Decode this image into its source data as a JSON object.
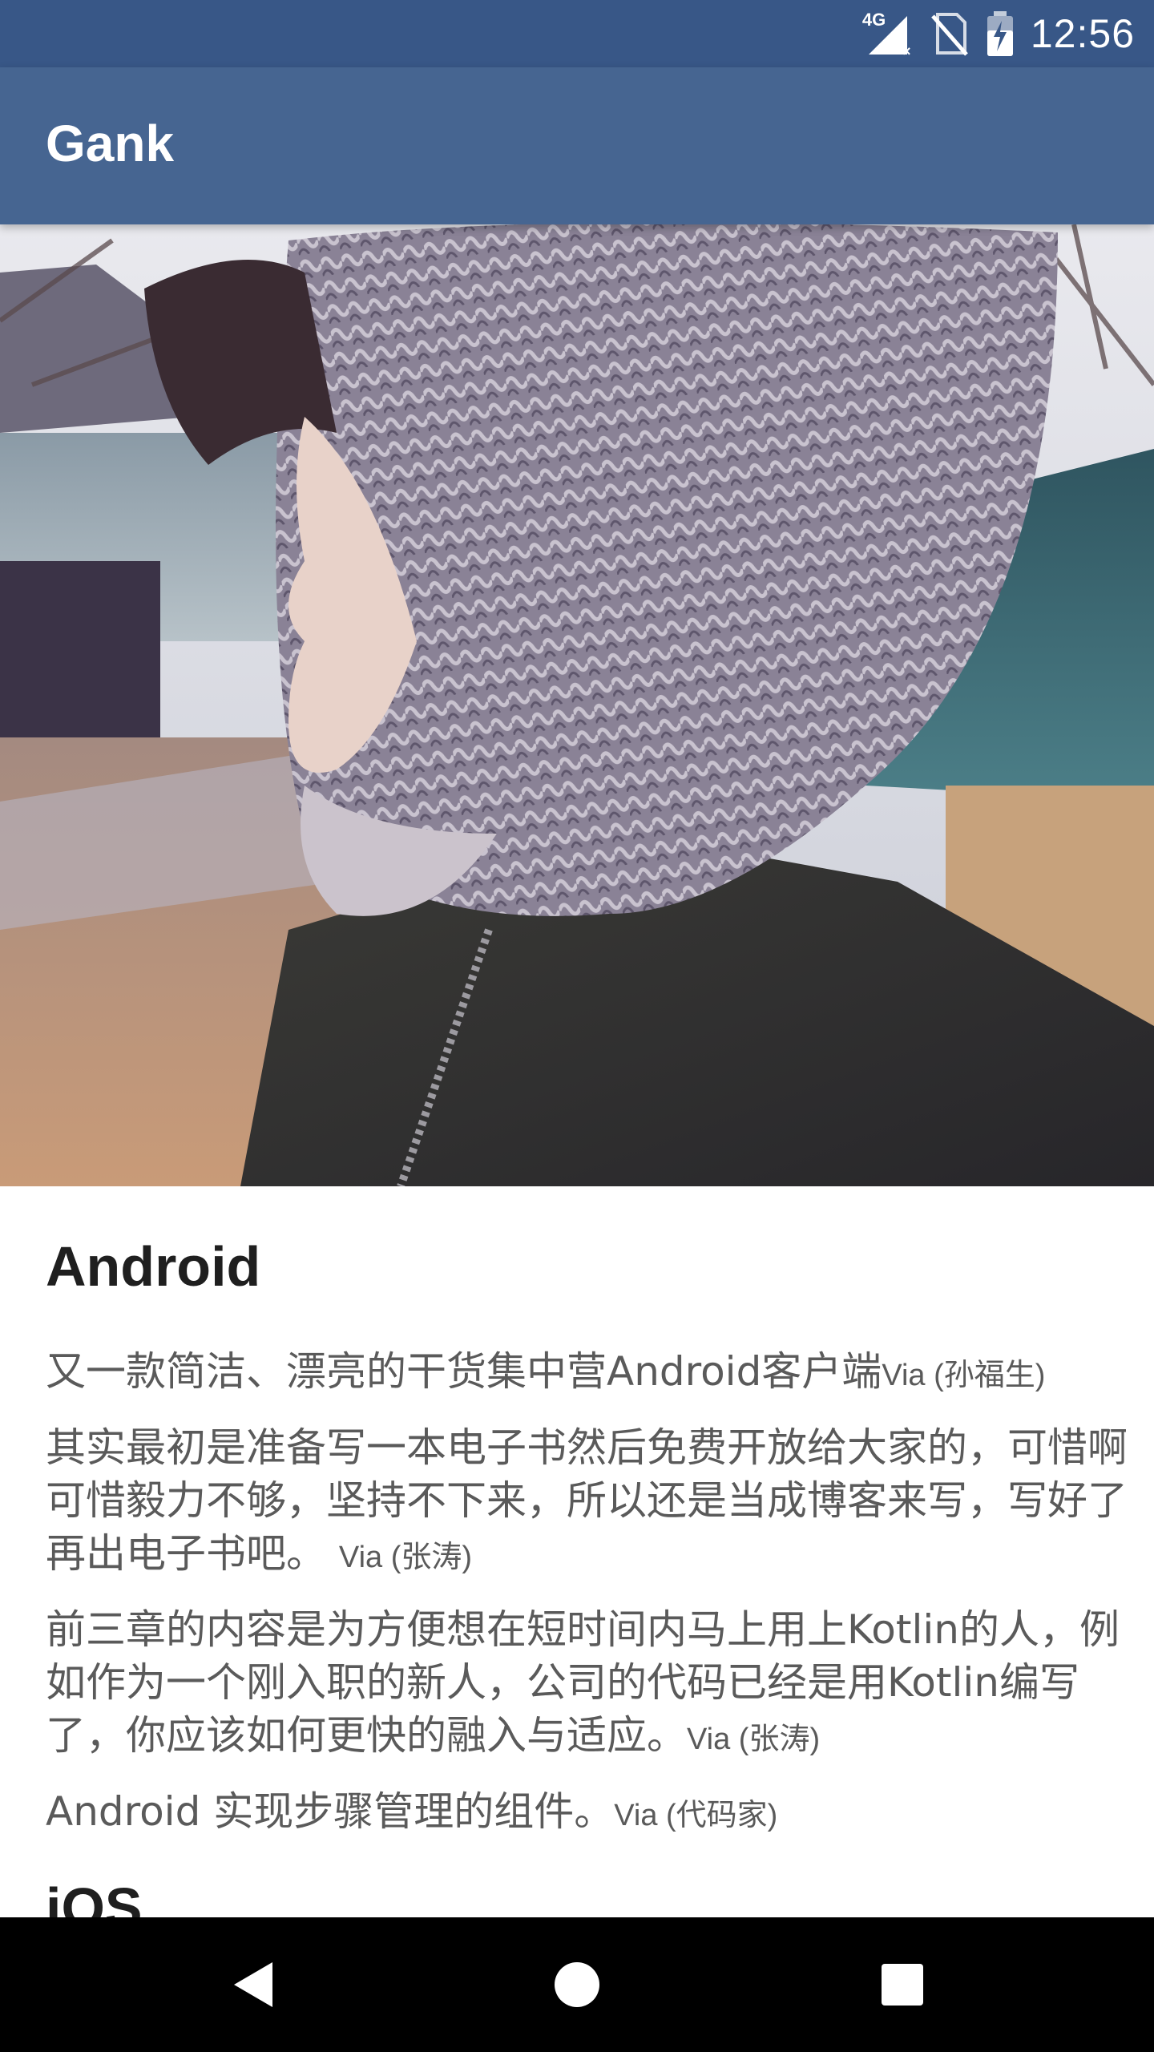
{
  "status_bar": {
    "network_label": "4G",
    "time": "12:56",
    "icons": [
      "signal-4g-icon",
      "no-sim-icon",
      "battery-charging-icon"
    ]
  },
  "app_bar": {
    "title": "Gank"
  },
  "hero": {
    "image": "photo-of-person-in-knit-hood"
  },
  "sections": [
    {
      "title": "Android",
      "entries": [
        {
          "text": "又一款简洁、漂亮的干货集中营Android客户端",
          "via": "Via (孙福生)"
        },
        {
          "text": "其实最初是准备写一本电子书然后免费开放给大家的，可惜啊可惜毅力不够，坚持不下来，所以还是当成博客来写，写好了再出电子书吧。",
          "via": "Via (张涛)"
        },
        {
          "text": "前三章的内容是为方便想在短时间内马上用上Kotlin的人，例如作为一个刚入职的新人，公司的代码已经是用Kotlin编写了，你应该如何更快的融入与适应。",
          "via": "Via (张涛)"
        },
        {
          "text": "Android 实现步骤管理的组件。",
          "via": "Via (代码家)"
        }
      ]
    },
    {
      "title": "iOS"
    }
  ],
  "nav_bar": {
    "buttons": [
      "back-icon",
      "home-icon",
      "recents-icon"
    ]
  },
  "colors": {
    "status_bar": "#385787",
    "app_bar": "#466591",
    "section_title": "#1f1f1f",
    "body_text": "#5a5a5a",
    "nav_bar": "#000000"
  }
}
